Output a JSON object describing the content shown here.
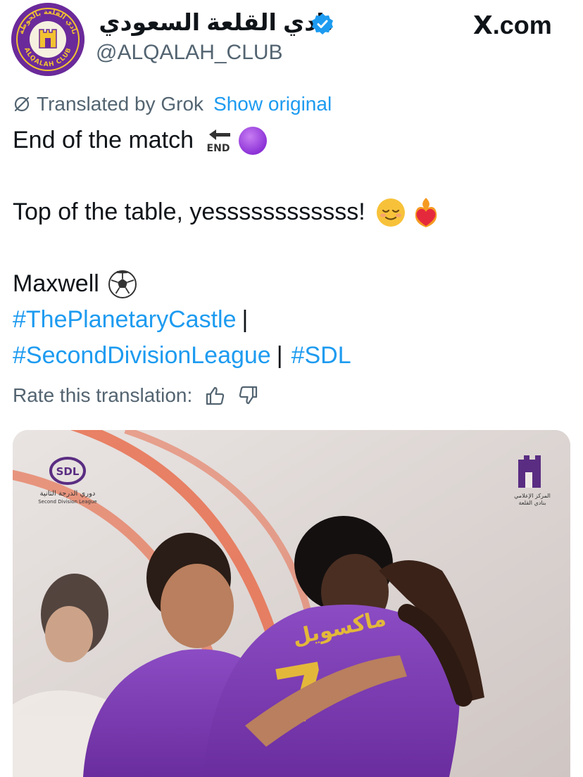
{
  "brand": {
    "site_label": ".com",
    "site_logo_letter": "X"
  },
  "account": {
    "display_name": "نادي القلعة السعودي",
    "handle": "@ALQALAH_CLUB",
    "verified": true,
    "avatar_text": "ALQALAH CLUB",
    "avatar_arabic_text": "نادي القلعة بالحوطة",
    "avatar_colors": {
      "ring": "#6b2a9a",
      "crest": "#f2c230"
    }
  },
  "translation": {
    "label": "Translated by Grok",
    "show_original_label": "Show original"
  },
  "tweet": {
    "line1": "End of the match",
    "line1_emojis": [
      "end-arrow-emoji",
      "purple-circle-emoji"
    ],
    "end_emoji_text": "END",
    "line2": "Top of the table, yessssssssssss!",
    "line2_emojis": [
      "relieved-face-emoji",
      "heart-on-fire-emoji"
    ],
    "line3": "Maxwell",
    "line3_emojis": [
      "soccer-ball-emoji"
    ],
    "hashtag1": "#ThePlanetaryCastle",
    "separator": "|",
    "hashtag2": "#SecondDivisionLeague",
    "hashtag3": "#SDL"
  },
  "rating": {
    "label": "Rate this translation:",
    "up_icon": "thumbs-up-icon",
    "down_icon": "thumbs-down-icon"
  },
  "media": {
    "league_logo_text": "SDL",
    "league_arabic": "دوري الدرجة الثانية",
    "league_english": "Second Division League",
    "club_media_arabic_line1": "المركز الإعلامي",
    "club_media_arabic_line2": "بنادي القلعة",
    "jersey_name": "ماكسويل",
    "jersey_number": "7",
    "colors": {
      "jersey": "#7b3fb0",
      "number": "#e3b83a",
      "track": "#e8603c"
    }
  },
  "colors": {
    "link": "#1d9bf0",
    "muted": "#536471",
    "text": "#0f1419"
  }
}
